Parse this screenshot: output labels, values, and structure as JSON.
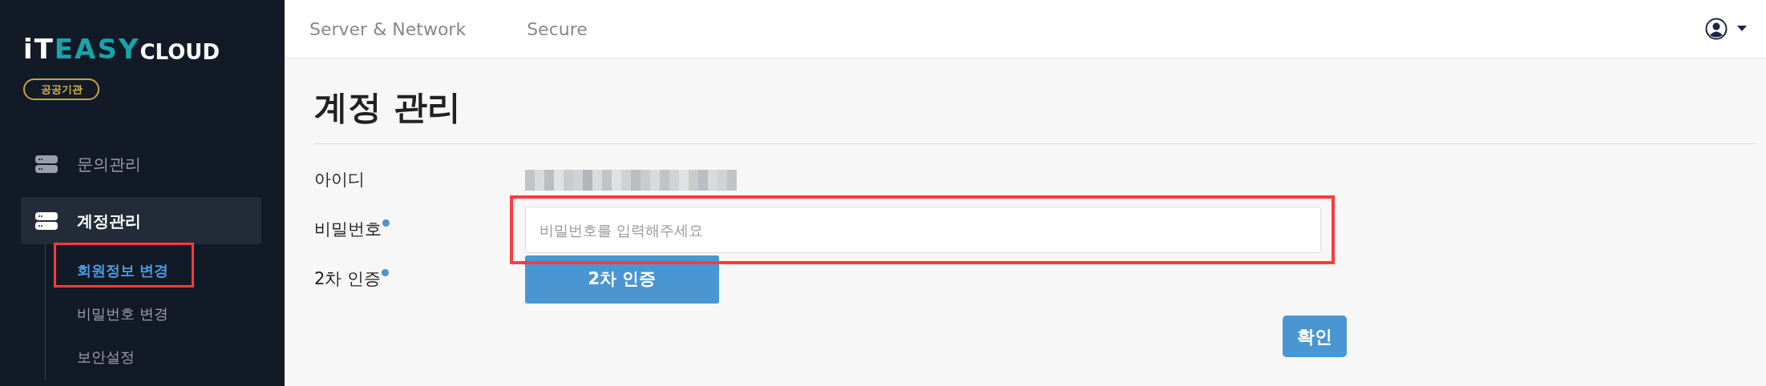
{
  "logo": {
    "parts": [
      {
        "text": "iT",
        "color": "#ffffff"
      },
      {
        "text": "EASY",
        "color": "#1aa3a8"
      },
      {
        "text": "CLOUD",
        "color": "#ffffff"
      }
    ]
  },
  "badge": "공공기관",
  "sidebar": {
    "items": [
      {
        "label": "문의관리",
        "selected": false
      },
      {
        "label": "계정관리",
        "selected": true,
        "expanded": true,
        "children": [
          {
            "label": "회원정보 변경",
            "selected": true,
            "highlighted": true
          },
          {
            "label": "비밀번호 변경",
            "selected": false,
            "highlighted": false
          },
          {
            "label": "보안설정",
            "selected": false,
            "highlighted": false
          }
        ]
      }
    ]
  },
  "top_nav": [
    {
      "label": "Server & Network",
      "selected": false
    },
    {
      "label": "Secure",
      "selected": false
    }
  ],
  "page_title": "계정 관리",
  "form": {
    "rows": [
      {
        "kind": "text",
        "label": "아이디",
        "required": false
      },
      {
        "kind": "input",
        "label": "비밀번호",
        "required": true,
        "placeholder": "비밀번호를 입력해주세요",
        "highlighted": true
      },
      {
        "kind": "button",
        "label": "2차 인증",
        "required": true,
        "button": "2차 인증"
      }
    ],
    "submit": "확인"
  }
}
